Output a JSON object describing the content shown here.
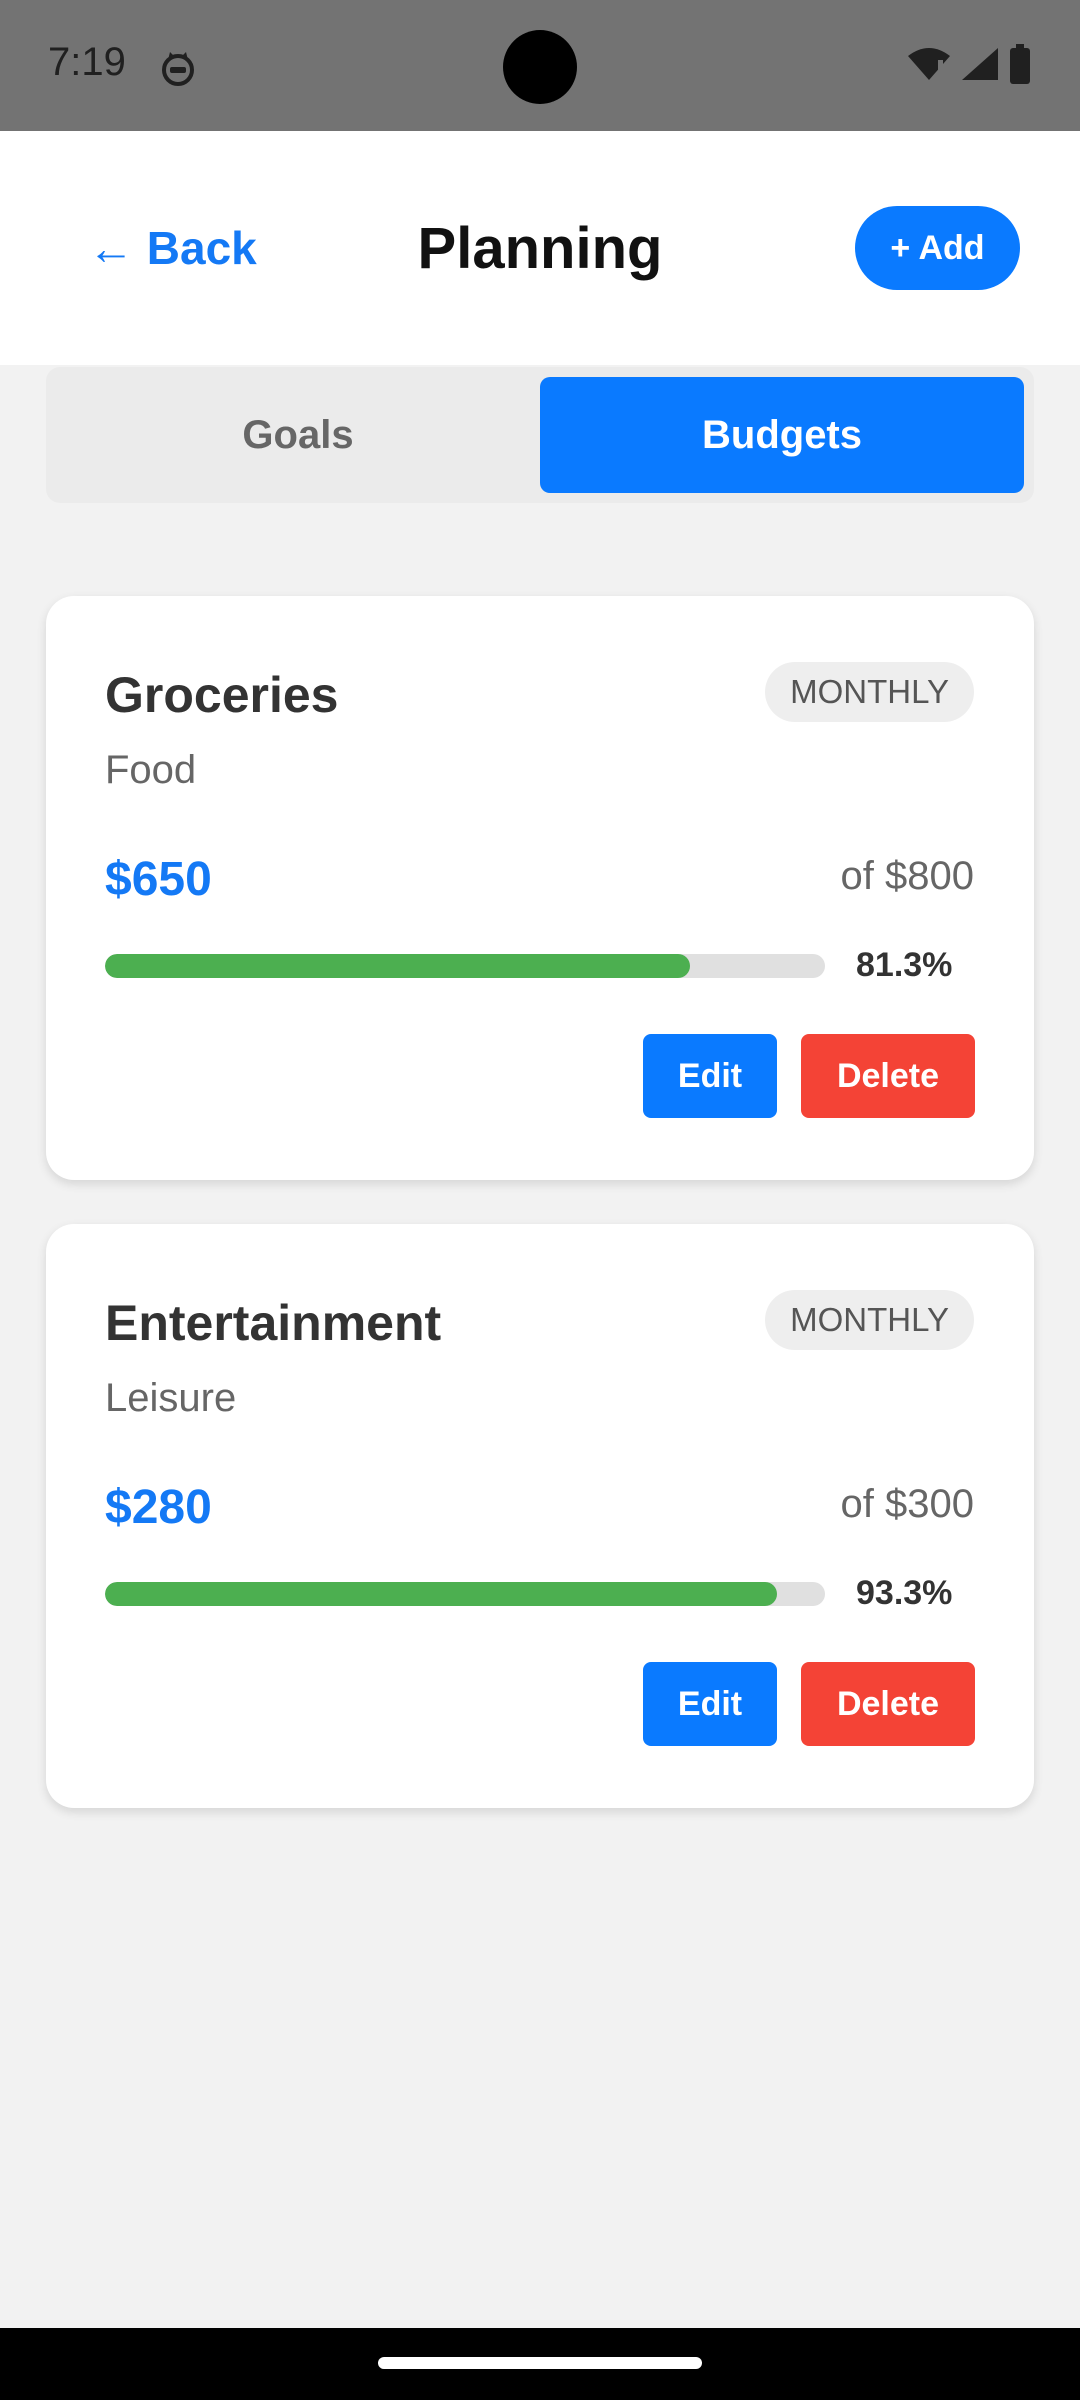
{
  "status_bar": {
    "time": "7:19",
    "icons": [
      "cat-icon",
      "wifi-icon",
      "signal-icon",
      "battery-icon"
    ]
  },
  "header": {
    "back_label": "← Back",
    "title": "Planning",
    "add_label": "+ Add"
  },
  "tabs": [
    {
      "label": "Goals",
      "active": false
    },
    {
      "label": "Budgets",
      "active": true
    }
  ],
  "budgets": [
    {
      "name": "Groceries",
      "category": "Food",
      "period": "MONTHLY",
      "spent": "$650",
      "limit": "of $800",
      "percent_label": "81.3%",
      "progress": 0.813,
      "edit_label": "Edit",
      "delete_label": "Delete"
    },
    {
      "name": "Entertainment",
      "category": "Leisure",
      "period": "MONTHLY",
      "spent": "$280",
      "limit": "of $300",
      "percent_label": "93.3%",
      "progress": 0.933,
      "edit_label": "Edit",
      "delete_label": "Delete"
    }
  ],
  "colors": {
    "accent": "#0a7aff",
    "danger": "#f44336",
    "progress": "#4caf50"
  }
}
